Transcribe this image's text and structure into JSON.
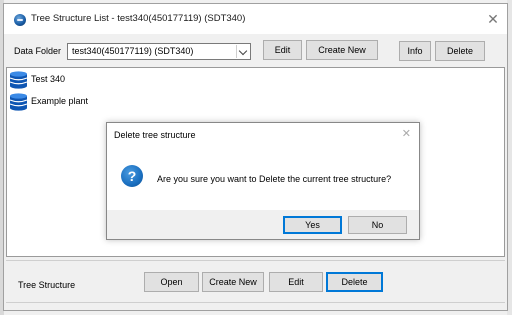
{
  "window": {
    "title": "Tree Structure List - test340(450177119) (SDT340)",
    "close_glyph": "✕"
  },
  "toolbar": {
    "data_folder_label": "Data Folder",
    "data_folder_value": "test340(450177119) (SDT340)",
    "edit_label": "Edit",
    "create_new_label": "Create New",
    "info_label": "Info",
    "delete_label": "Delete"
  },
  "tree": {
    "items": [
      {
        "label": "Test 340",
        "icon": "database-icon"
      },
      {
        "label": "Example plant",
        "icon": "database-icon"
      }
    ]
  },
  "footer": {
    "section_label": "Tree Structure",
    "open_label": "Open",
    "create_new_label": "Create New",
    "edit_label": "Edit",
    "delete_label": "Delete"
  },
  "dialog": {
    "title": "Delete tree structure",
    "close_glyph": "✕",
    "icon_glyph": "?",
    "message": "Are you sure you want to Delete the current tree structure?",
    "yes_label": "Yes",
    "no_label": "No"
  },
  "colors": {
    "accent": "#0078d7",
    "question_icon": "#1a6fc0"
  }
}
